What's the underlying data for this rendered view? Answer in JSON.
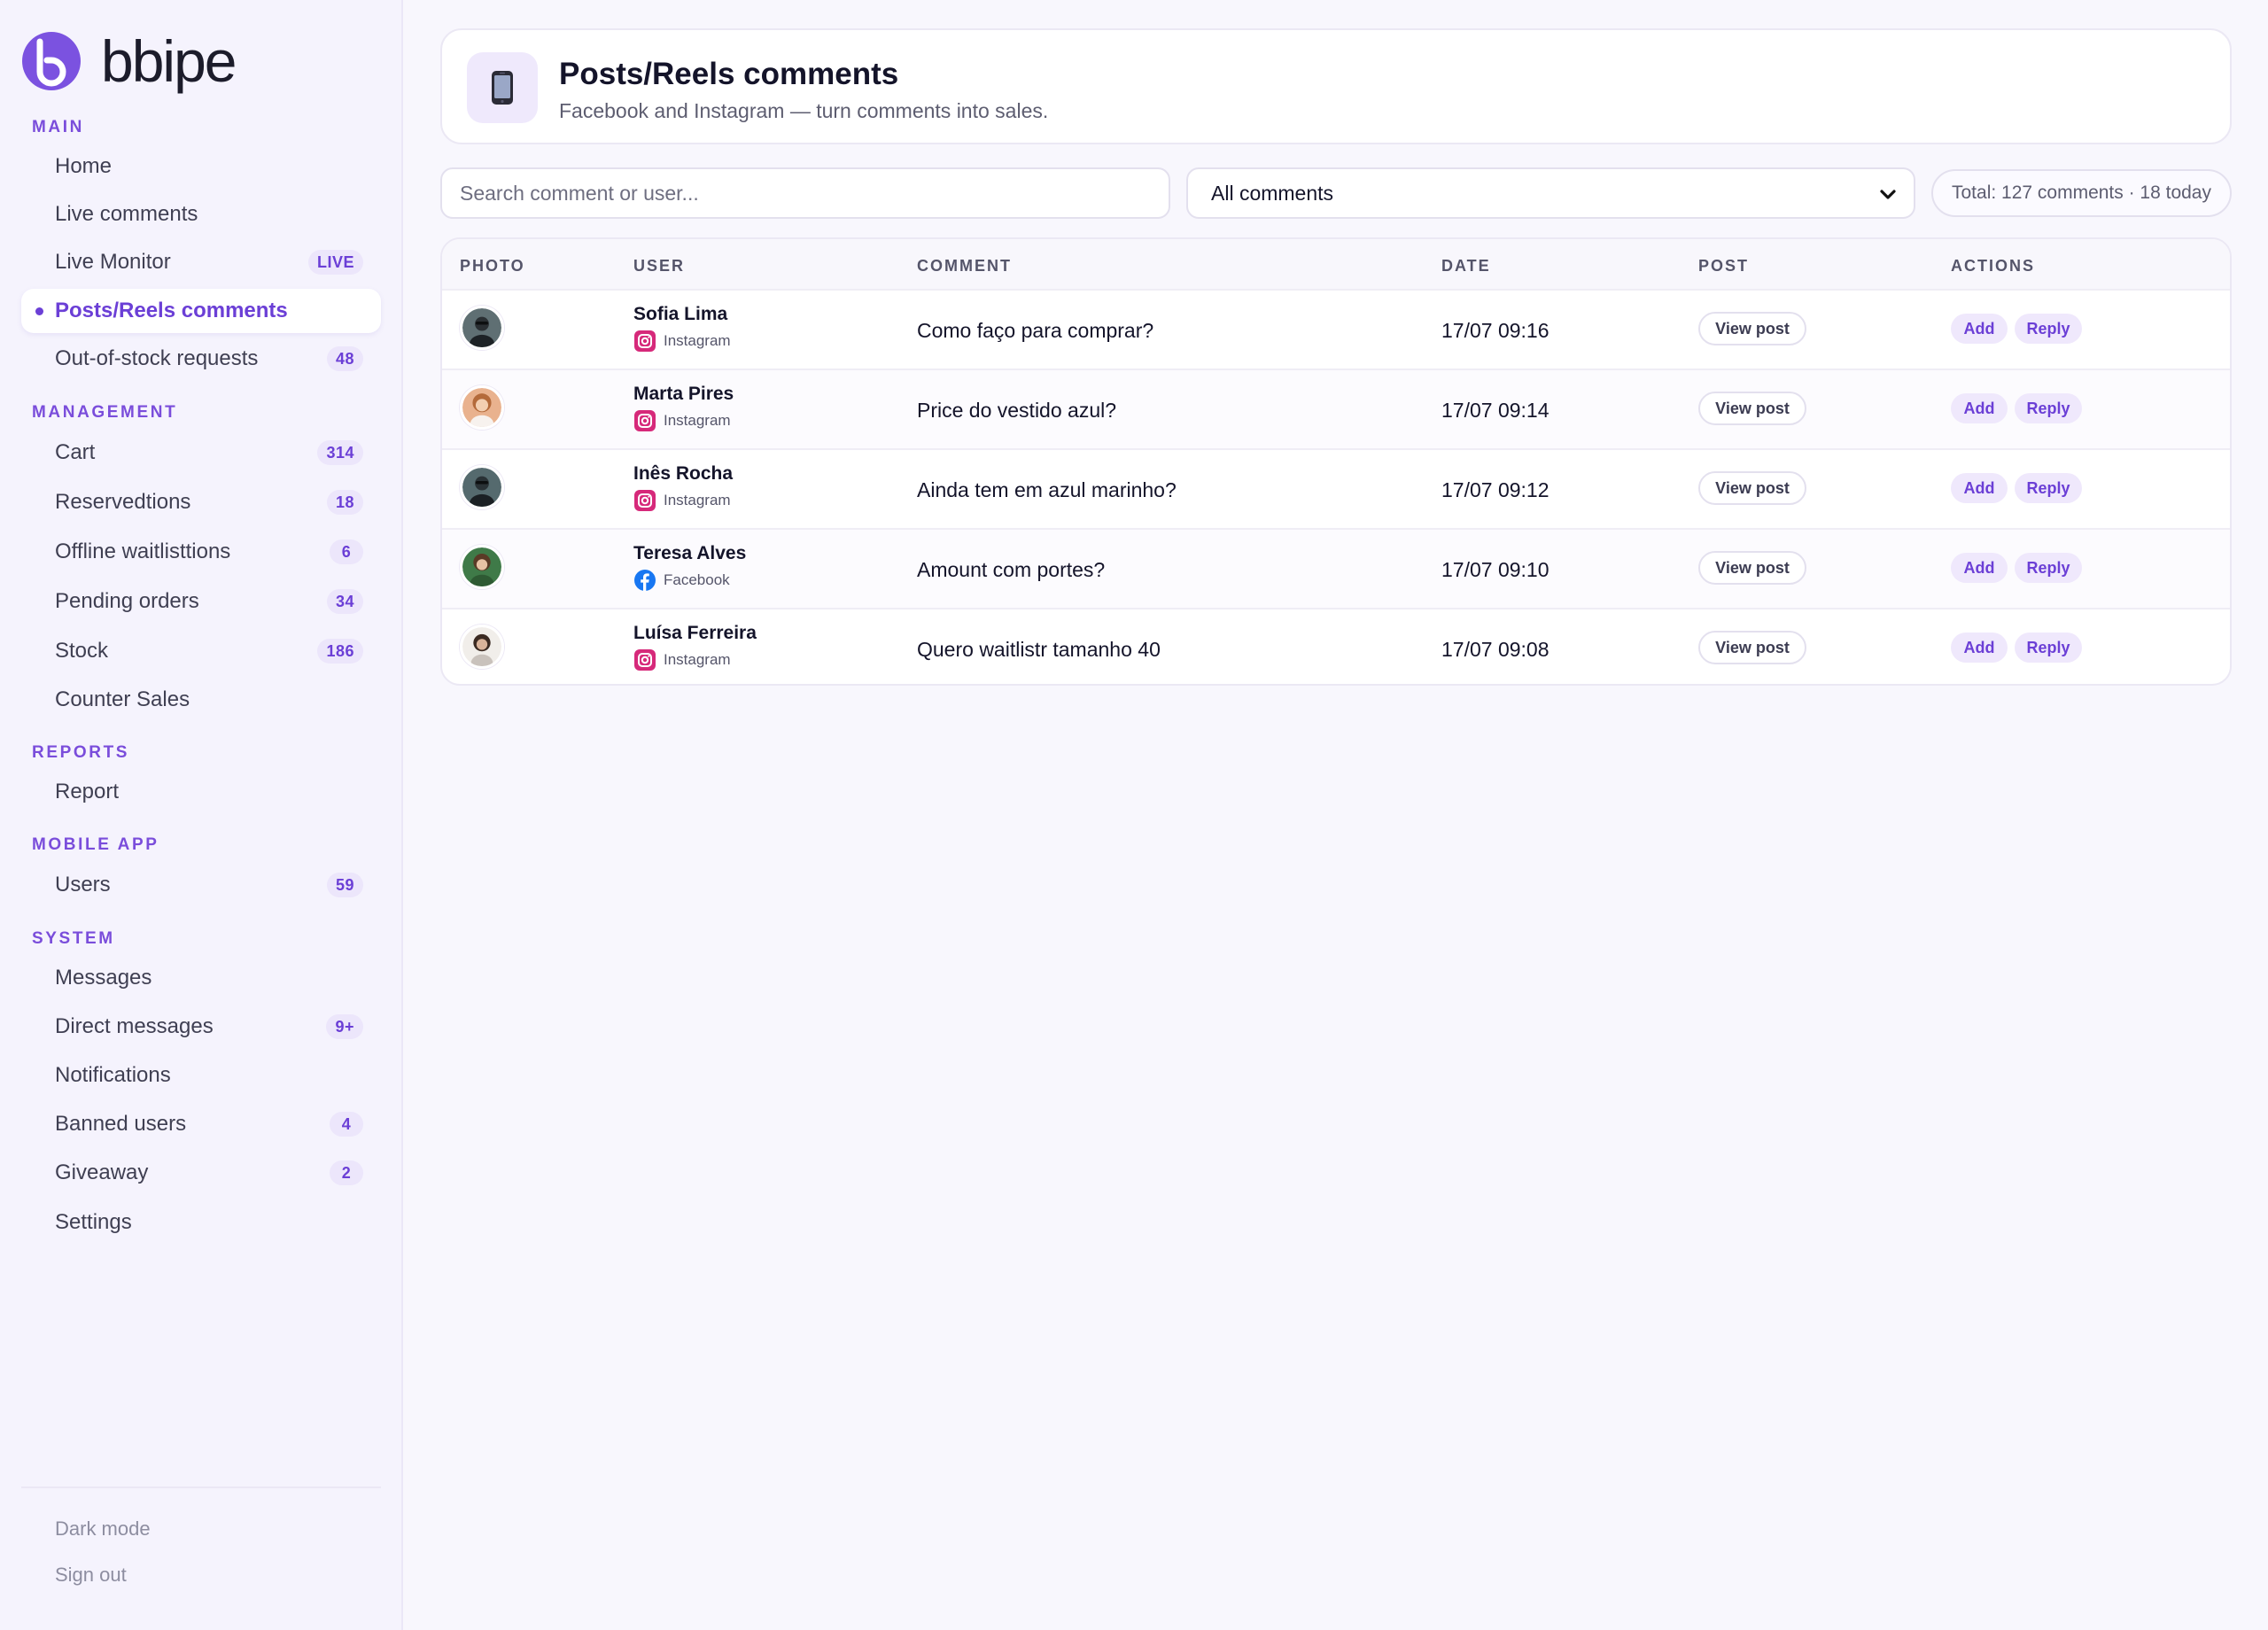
{
  "app": {
    "logo_text": "bbipe",
    "brand_color": "#6b3fd6"
  },
  "sidebar": {
    "sections": [
      {
        "title": "MAIN",
        "items": [
          {
            "label": "Home",
            "badge": ""
          },
          {
            "label": "Live comments",
            "badge": ""
          },
          {
            "label": "Live Monitor",
            "badge": "LIVE"
          },
          {
            "label": "Posts/Reels comments",
            "badge": "",
            "active": true
          },
          {
            "label": "Out-of-stock requests",
            "badge": "48"
          }
        ]
      },
      {
        "title": "MANAGEMENT",
        "items": [
          {
            "label": "Cart",
            "badge": "314"
          },
          {
            "label": "Reservedtions",
            "badge": "18"
          },
          {
            "label": "Offline waitlisttions",
            "badge": "6"
          },
          {
            "label": "Pending orders",
            "badge": "34"
          },
          {
            "label": "Stock",
            "badge": "186"
          },
          {
            "label": "Counter Sales",
            "badge": ""
          }
        ]
      },
      {
        "title": "REPORTS",
        "items": [
          {
            "label": "Report",
            "badge": ""
          }
        ]
      },
      {
        "title": "MOBILE APP",
        "items": [
          {
            "label": "Users",
            "badge": "59"
          }
        ]
      },
      {
        "title": "SYSTEM",
        "items": [
          {
            "label": "Messages",
            "badge": ""
          },
          {
            "label": "Direct messages",
            "badge": "9+"
          },
          {
            "label": "Notifications",
            "badge": ""
          },
          {
            "label": "Banned users",
            "badge": "4"
          },
          {
            "label": "Giveaway",
            "badge": "2"
          },
          {
            "label": "Settings",
            "badge": ""
          }
        ]
      }
    ],
    "footer": {
      "dark_mode": "Dark mode",
      "sign_out": "Sign out"
    }
  },
  "header": {
    "icon": "mobile-phone-icon",
    "title": "Posts/Reels comments",
    "subtitle": "Facebook and Instagram — turn comments into sales."
  },
  "toolbar": {
    "search_placeholder": "Search comment or user...",
    "filter_value": "All comments",
    "total_text": "Total: 127 comments · 18 today"
  },
  "table": {
    "columns": [
      "PHOTO",
      "USER",
      "COMMENT",
      "DATE",
      "POST",
      "ACTIONS"
    ],
    "view_post_label": "View post",
    "add_label": "Add",
    "reply_label": "Reply",
    "rows": [
      {
        "user": "Sofia Lima",
        "platform": "Instagram",
        "comment": "Como faço para comprar?",
        "date": "17/07 09:16"
      },
      {
        "user": "Marta Pires",
        "platform": "Instagram",
        "comment": "Price do vestido azul?",
        "date": "17/07 09:14"
      },
      {
        "user": "Inês Rocha",
        "platform": "Instagram",
        "comment": "Ainda tem em azul marinho?",
        "date": "17/07 09:12"
      },
      {
        "user": "Teresa Alves",
        "platform": "Facebook",
        "comment": "Amount com portes?",
        "date": "17/07 09:10"
      },
      {
        "user": "Luísa Ferreira",
        "platform": "Instagram",
        "comment": "Quero waitlistr tamanho 40",
        "date": "17/07 09:08"
      }
    ]
  }
}
